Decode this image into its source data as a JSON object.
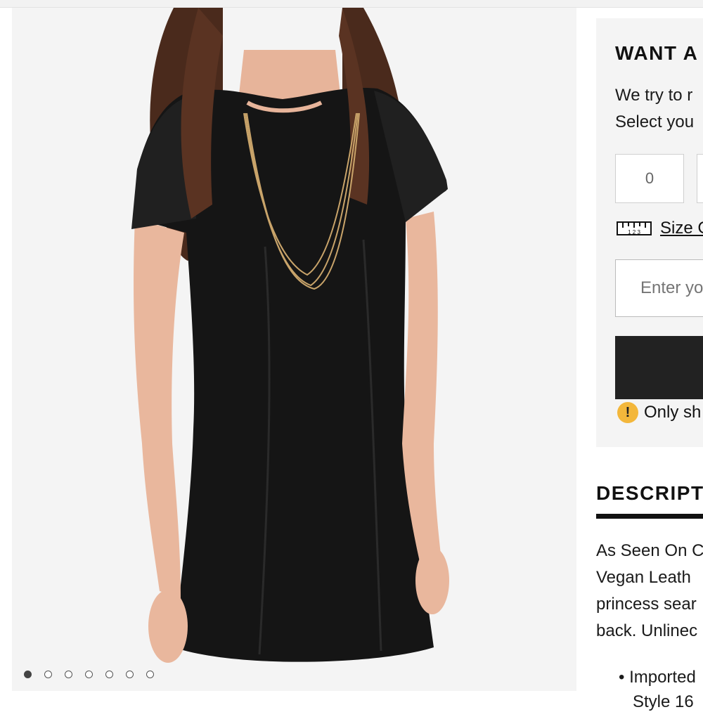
{
  "gallery": {
    "image_alt": "Model wearing black short-sleeve vegan leather dress with layered gold necklace",
    "dots": [
      true,
      false,
      false,
      false,
      false,
      false,
      false
    ]
  },
  "notify_panel": {
    "title": "WANT A",
    "line1": "We try to r",
    "line2": "Select you",
    "quantity_value": "0",
    "size_chart_link": "Size C",
    "ruler_digits": "1 2 3",
    "email_placeholder": "Enter yo",
    "alert_icon_glyph": "!",
    "alert_text": "Only sh"
  },
  "description": {
    "title": "DESCRIPTI",
    "lines": [
      "As Seen On C",
      "Vegan Leath",
      "princess sear",
      "back. Unlinec"
    ],
    "bullets": [
      "Imported",
      "Style 16"
    ]
  },
  "colors": {
    "panel_bg": "#f4f4f4",
    "button_bg": "#222222",
    "alert_accent": "#f3b73b"
  }
}
